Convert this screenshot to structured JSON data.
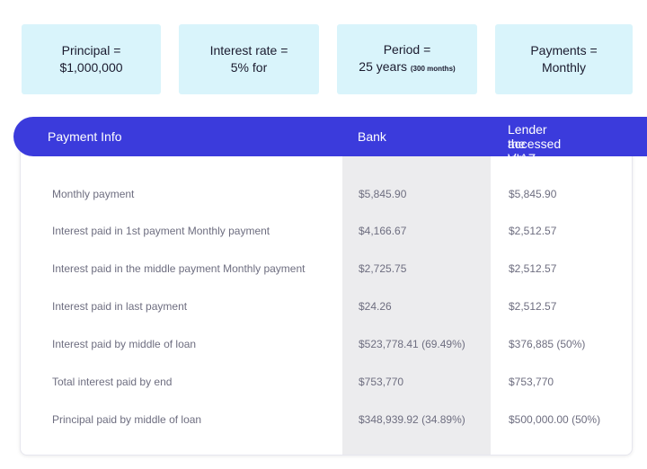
{
  "cards": [
    {
      "line1": "Principal =",
      "line2": "$1,000,000",
      "small": ""
    },
    {
      "line1": "Interest rate =",
      "line2": "5% for",
      "small": ""
    },
    {
      "line1": "Period =",
      "line2": "25 years ",
      "small": "(300 months)"
    },
    {
      "line1": "Payments =",
      "line2": "Monthly",
      "small": ""
    }
  ],
  "table": {
    "headers": {
      "info": "Payment Info",
      "bank": "Bank",
      "lender_line1": "Lender accessed via",
      "lender_line2": "the VIAZ Platform"
    },
    "rows": [
      {
        "label": "Monthly payment",
        "bank": "$5,845.90",
        "lender": "$5,845.90"
      },
      {
        "label": "Interest paid in 1st payment Monthly payment",
        "bank": "$4,166.67",
        "lender": "$2,512.57"
      },
      {
        "label": "Interest paid in the middle payment Monthly payment",
        "bank": "$2,725.75",
        "lender": "$2,512.57"
      },
      {
        "label": "Interest paid in last payment",
        "bank": "$24.26",
        "lender": "$2,512.57"
      },
      {
        "label": "Interest paid by middle of loan",
        "bank": "$523,778.41 (69.49%)",
        "lender": "$376,885 (50%)"
      },
      {
        "label": "Total interest paid by end",
        "bank": "$753,770",
        "lender": "$753,770"
      },
      {
        "label": "Principal paid by middle of loan",
        "bank": "$348,939.92 (34.89%)",
        "lender": "$500,000.00 (50%)"
      }
    ]
  }
}
